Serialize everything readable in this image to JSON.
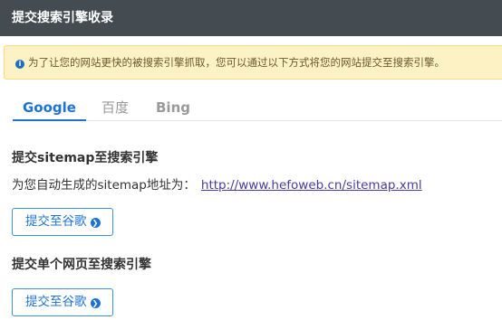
{
  "header": {
    "title": "提交搜索引擎收录"
  },
  "notice": {
    "icon": "info-icon",
    "icon_glyph": "i",
    "text": "为了让您的网站更快的被搜索引擎抓取，您可以通过以下方式将您的网站提交至搜索引擎。"
  },
  "tabs": [
    {
      "label": "Google",
      "active": true
    },
    {
      "label": "百度",
      "active": false
    },
    {
      "label": "Bing",
      "active": false
    }
  ],
  "sitemap_section": {
    "title": "提交sitemap至搜索引擎",
    "description": "为您自动生成的sitemap地址为：",
    "url": "http://www.hefoweb.cn/sitemap.xml",
    "button_label": "提交至谷歌"
  },
  "page_section": {
    "title": "提交单个网页至搜索引擎",
    "button_label": "提交至谷歌"
  },
  "colors": {
    "header_bg": "#444b51",
    "notice_bg": "#fcf2c4",
    "accent": "#1e73d2",
    "link": "#4a3aa3"
  }
}
